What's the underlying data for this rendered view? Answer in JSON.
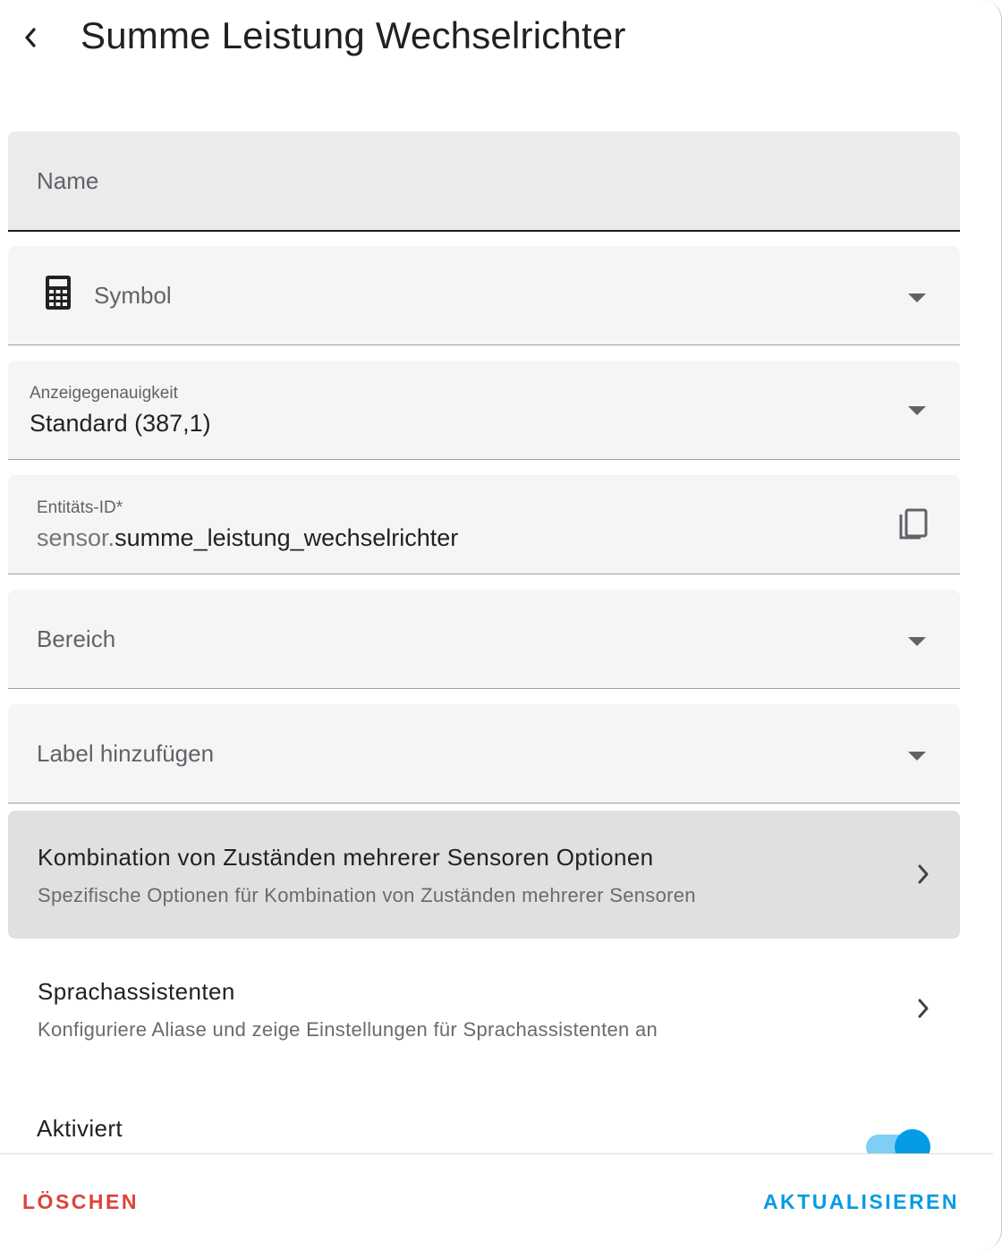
{
  "header": {
    "title": "Summe Leistung Wechselrichter"
  },
  "fields": {
    "name": {
      "placeholder": "Name"
    },
    "symbol": {
      "placeholder": "Symbol"
    },
    "precision": {
      "label": "Anzeigegenauigkeit",
      "value": "Standard (387,1)"
    },
    "entity_id": {
      "label": "Entitäts-ID*",
      "prefix": "sensor.",
      "value": "summe_leistung_wechselrichter"
    },
    "area": {
      "placeholder": "Bereich"
    },
    "labels": {
      "placeholder": "Label hinzufügen"
    }
  },
  "sections": {
    "combine_options": {
      "title": "Kombination von Zuständen mehrerer Sensoren Optionen",
      "subtitle": "Spezifische Optionen für Kombination von Zuständen mehrerer Sensoren"
    },
    "voice_assistants": {
      "title": "Sprachassistenten",
      "subtitle": "Konfiguriere Aliase und zeige Einstellungen für Sprachassistenten an"
    }
  },
  "enabled": {
    "label": "Aktiviert",
    "value": true
  },
  "footer": {
    "delete_label": "LÖSCHEN",
    "update_label": "AKTUALISIEREN"
  },
  "colors": {
    "accent": "#039be5",
    "danger": "#db4437",
    "highlight_row": "#e0e0e0"
  },
  "icons": {
    "back": "chevron-left-icon",
    "symbol": "calculator-icon",
    "copy": "copy-icon",
    "dropdown": "caret-down-icon",
    "navigate": "chevron-right-icon"
  }
}
